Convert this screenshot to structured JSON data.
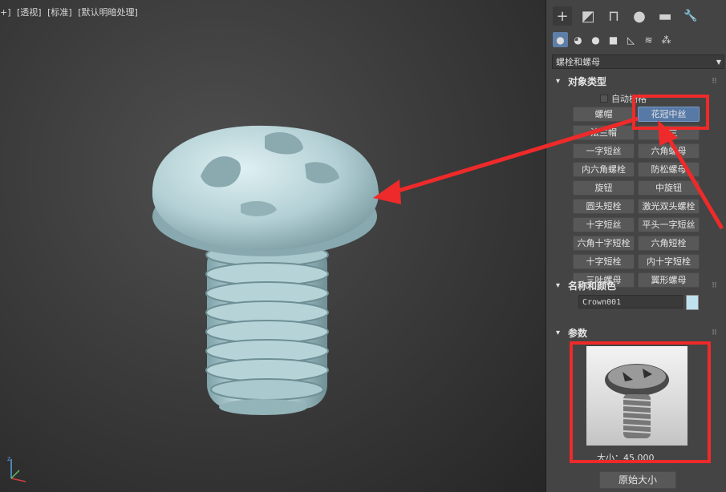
{
  "viewport": {
    "labels": [
      "+]",
      "[透视]",
      "[标准]",
      "[默认明暗处理]"
    ]
  },
  "panel": {
    "tabs": [
      {
        "icon": "plus-icon",
        "glyph": "+"
      },
      {
        "icon": "modify-icon",
        "glyph": "◩"
      },
      {
        "icon": "hierarchy-icon",
        "glyph": "⊓"
      },
      {
        "icon": "motion-icon",
        "glyph": "●"
      },
      {
        "icon": "display-icon",
        "glyph": "▬"
      },
      {
        "icon": "utilities-icon",
        "glyph": "🔧"
      }
    ],
    "categories": [
      {
        "icon": "geometry-icon",
        "glyph": "●"
      },
      {
        "icon": "shapes-icon",
        "glyph": "◕"
      },
      {
        "icon": "lights-icon",
        "glyph": "●"
      },
      {
        "icon": "cameras-icon",
        "glyph": "■"
      },
      {
        "icon": "helpers-icon",
        "glyph": "◺"
      },
      {
        "icon": "spacewarps-icon",
        "glyph": "≋"
      },
      {
        "icon": "systems-icon",
        "glyph": "⁂"
      }
    ],
    "dropdown": "螺栓和螺母",
    "object_type": {
      "title": "对象类型",
      "autogrid": "自动栅格",
      "buttons": [
        "螺帽",
        "花冠中丝",
        "法兰帽",
        "法兰",
        "一字短丝",
        "六角螺母",
        "内六角螺栓",
        "防松螺母",
        "旋钮",
        "中旋钮",
        "圆头短栓",
        "激光双头螺栓",
        "十字短丝",
        "平头一字短丝",
        "六角十字短栓",
        "六角短栓",
        "十字短栓",
        "内十字短栓",
        "三叶螺母",
        "翼形螺母"
      ],
      "selected_index": 1
    },
    "name_color": {
      "title": "名称和颜色",
      "name_value": "Crown001",
      "color": "#bfe2ee"
    },
    "params": {
      "title": "参数",
      "size_text": "大小：45.000",
      "orig_button": "原始大小"
    }
  },
  "annotation_color": "#ee2a2a"
}
